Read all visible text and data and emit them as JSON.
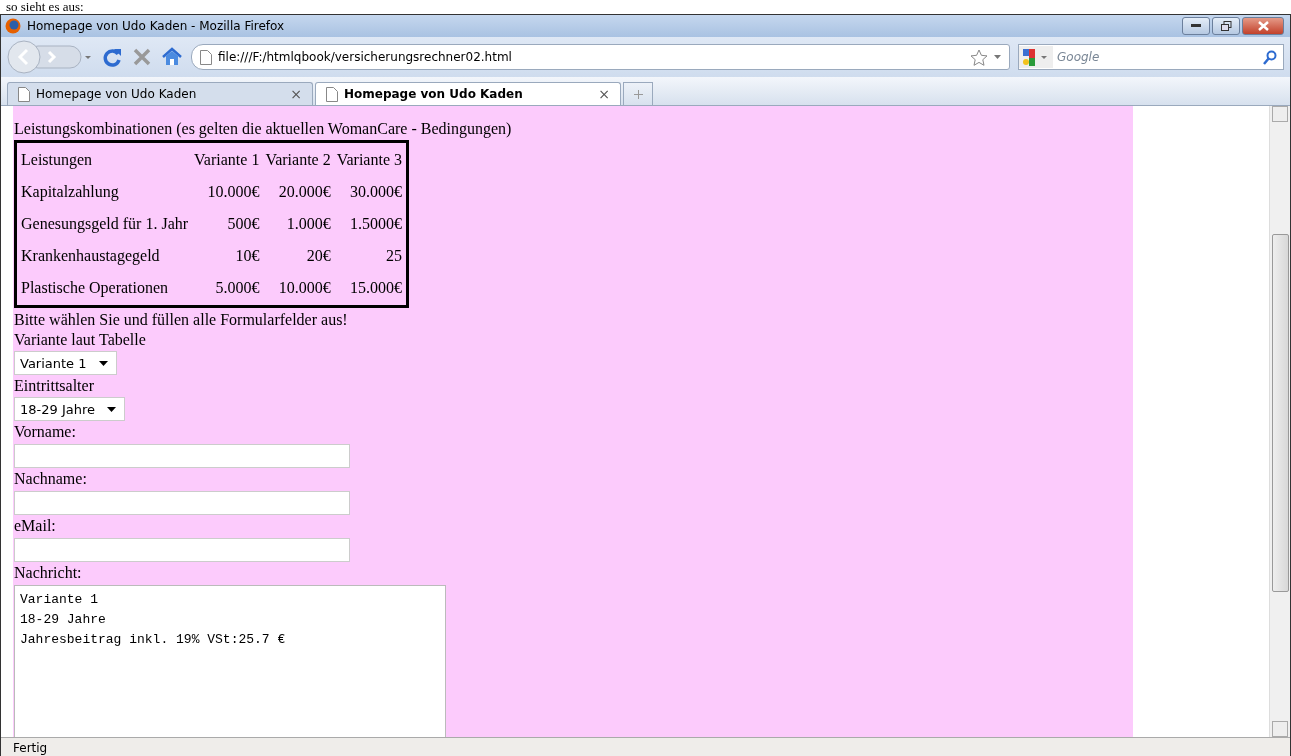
{
  "caption": "so sieht es aus:",
  "window": {
    "title": "Homepage von Udo Kaden - Mozilla Firefox"
  },
  "toolbar": {
    "url": "file:///F:/htmlqbook/versicherungsrechner02.html",
    "search_placeholder": "Google"
  },
  "tabs": [
    {
      "label": "Homepage von Udo Kaden",
      "selected": false,
      "close": "×"
    },
    {
      "label": "Homepage von Udo Kaden",
      "selected": true,
      "close": "×"
    }
  ],
  "page": {
    "heading": "Leistungskombinationen (es gelten die aktuellen WomanCare - Bedingungen)",
    "table": {
      "columns": [
        "Leistungen",
        "Variante 1",
        "Variante 2",
        "Variante 3"
      ],
      "rows": [
        [
          "Kapitalzahlung",
          "10.000€",
          "20.000€",
          "30.000€"
        ],
        [
          "Genesungsgeld für 1. Jahr",
          "500€",
          "1.000€",
          "1.5000€"
        ],
        [
          "Krankenhaustagegeld",
          "10€",
          "20€",
          "25"
        ],
        [
          "Plastische Operationen",
          "5.000€",
          "10.000€",
          "15.000€"
        ]
      ]
    },
    "instruction": "Bitte wählen Sie und füllen alle Formularfelder aus!",
    "fields": [
      {
        "kind": "select",
        "label": "Variante laut Tabelle",
        "value": "Variante 1"
      },
      {
        "kind": "select",
        "label": "Eintrittsalter",
        "value": "18-29 Jahre"
      },
      {
        "kind": "text",
        "label": "Vorname:"
      },
      {
        "kind": "text",
        "label": "Nachname:"
      },
      {
        "kind": "text",
        "label": "eMail:"
      },
      {
        "kind": "textarea",
        "label": "Nachricht:",
        "value": "Variante 1\n18-29 Jahre\nJahresbeitrag inkl. 19% VSt:25.7 €"
      }
    ]
  },
  "status_bar": {
    "text": "Fertig"
  }
}
